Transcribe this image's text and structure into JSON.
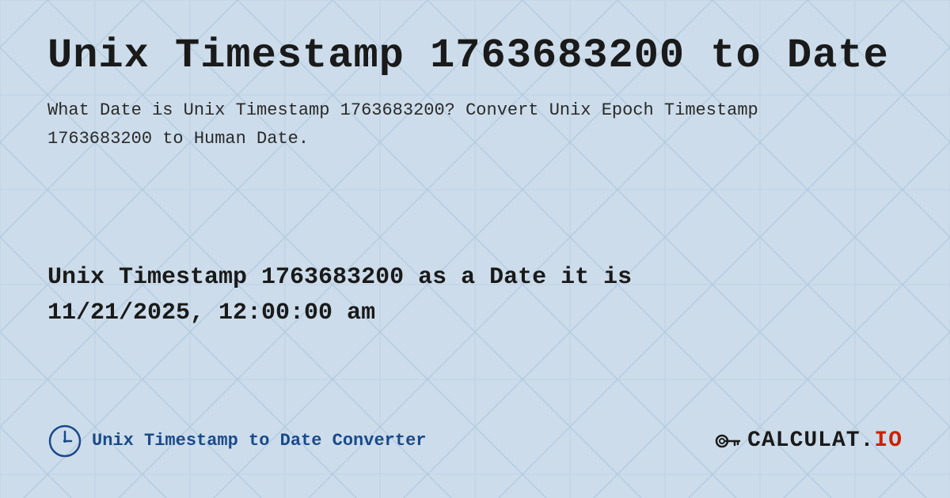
{
  "page": {
    "title": "Unix Timestamp 1763683200 to Date",
    "description": "What Date is Unix Timestamp 1763683200? Convert Unix Epoch Timestamp 1763683200 to Human Date.",
    "result_line1": "Unix Timestamp 1763683200 as a Date it is",
    "result_line2": "11/21/2025, 12:00:00 am",
    "footer_label": "Unix Timestamp to Date Converter",
    "logo_text": "CALCULAT.IO",
    "background_color": "#c8d8e8",
    "accent_color": "#1a4a8a"
  }
}
